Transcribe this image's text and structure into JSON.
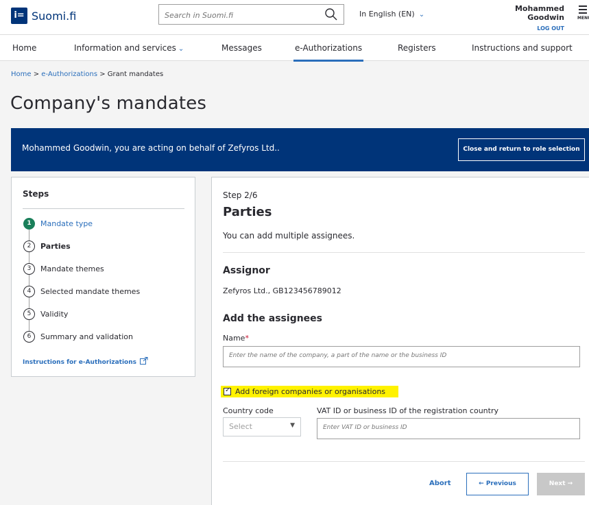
{
  "header": {
    "logo_mark": "i=",
    "logo_text": "Suomi.fi",
    "search_placeholder": "Search in Suomi.fi",
    "language": "In English (EN)",
    "user_name": "Mohammed Goodwin",
    "logout": "LOG OUT",
    "menu_label": "MENU"
  },
  "nav": {
    "items": [
      "Home",
      "Information and services",
      "Messages",
      "e-Authorizations",
      "Registers",
      "Instructions and support"
    ],
    "active": "e-Authorizations"
  },
  "breadcrumb": {
    "home": "Home",
    "sep": ">",
    "eauth": "e-Authorizations",
    "current": "Grant mandates"
  },
  "page_title": "Company's mandates",
  "banner": {
    "text": "Mohammed Goodwin, you are acting on behalf of Zefyros Ltd..",
    "button": "Close and return to role selection"
  },
  "steps": {
    "title": "Steps",
    "items": [
      {
        "num": "1",
        "label": "Mandate type"
      },
      {
        "num": "2",
        "label": "Parties"
      },
      {
        "num": "3",
        "label": "Mandate themes"
      },
      {
        "num": "4",
        "label": "Selected mandate themes"
      },
      {
        "num": "5",
        "label": "Validity"
      },
      {
        "num": "6",
        "label": "Summary and validation"
      }
    ],
    "instructions": "Instructions for e-Authorizations"
  },
  "main": {
    "step_label": "Step 2/6",
    "heading": "Parties",
    "intro": "You can add multiple assignees.",
    "assignor_heading": "Assignor",
    "assignor_value": "Zefyros Ltd., GB123456789012",
    "assignees_heading": "Add the assignees",
    "name_label": "Name",
    "name_required": "*",
    "name_placeholder": "Enter the name of the company, a part of the name or the business ID",
    "foreign_label": "Add foreign companies or organisations",
    "country_code_label": "Country code",
    "country_code_placeholder": "Select",
    "vat_label": "VAT ID or business ID of the registration country",
    "vat_placeholder": "Enter VAT ID or business ID",
    "abort": "Abort",
    "previous": "← Previous",
    "next": "Next →"
  }
}
